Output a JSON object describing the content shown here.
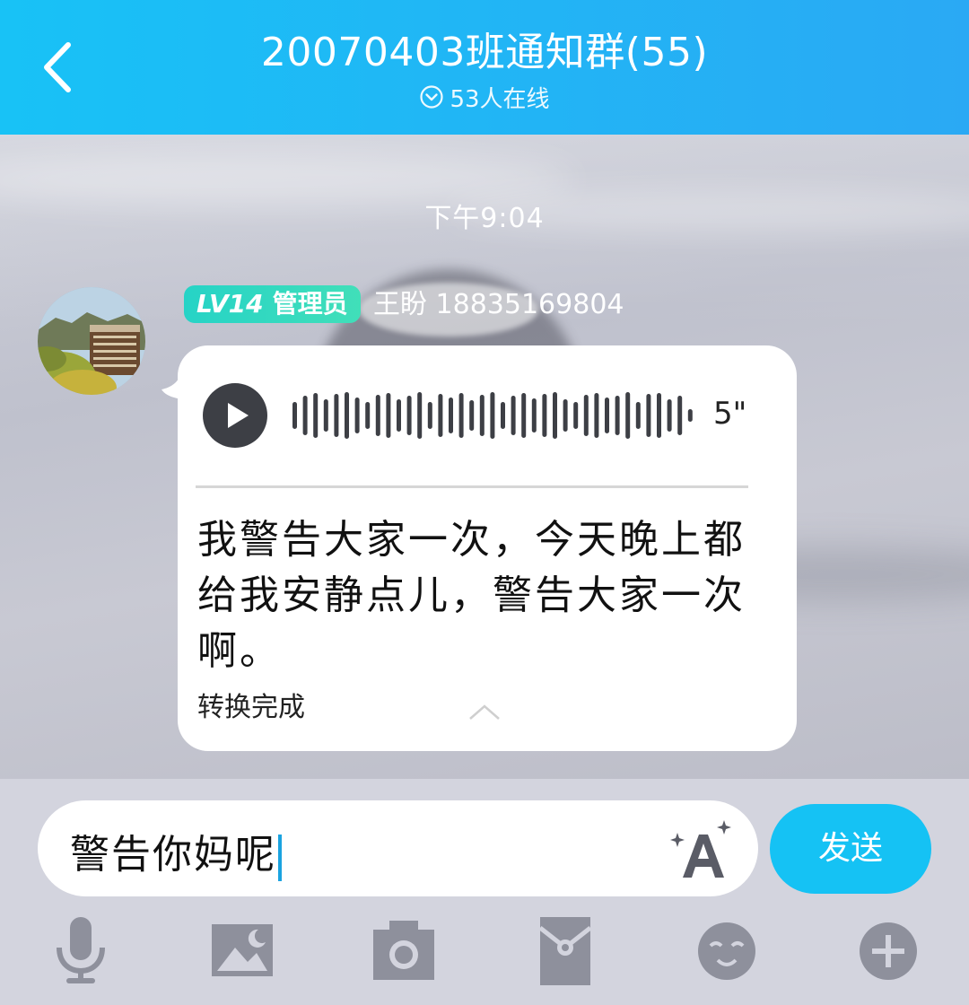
{
  "header": {
    "title": "20070403班通知群(55)",
    "online_text": "53人在线",
    "back_icon": "chevron-left-icon"
  },
  "chat": {
    "timestamp": "下午9:04",
    "message": {
      "level_badge": "LV14",
      "role_badge": "管理员",
      "sender": "王盼 18835169804",
      "voice_duration": "5\"",
      "transcript": "我警告大家一次，今天晚上都给我安静点儿，警告大家一次啊。",
      "transcript_status": "转换完成"
    }
  },
  "composer": {
    "input_value": "警告你妈呢",
    "send_label": "发送"
  },
  "toolbar": {
    "items": [
      "microphone-icon",
      "image-icon",
      "camera-icon",
      "red-packet-icon",
      "emoji-icon",
      "plus-icon"
    ]
  },
  "colors": {
    "header": "#18c2f6",
    "send": "#15c2f4",
    "badge": "#2fd6c3",
    "icon": "#8e909c"
  }
}
